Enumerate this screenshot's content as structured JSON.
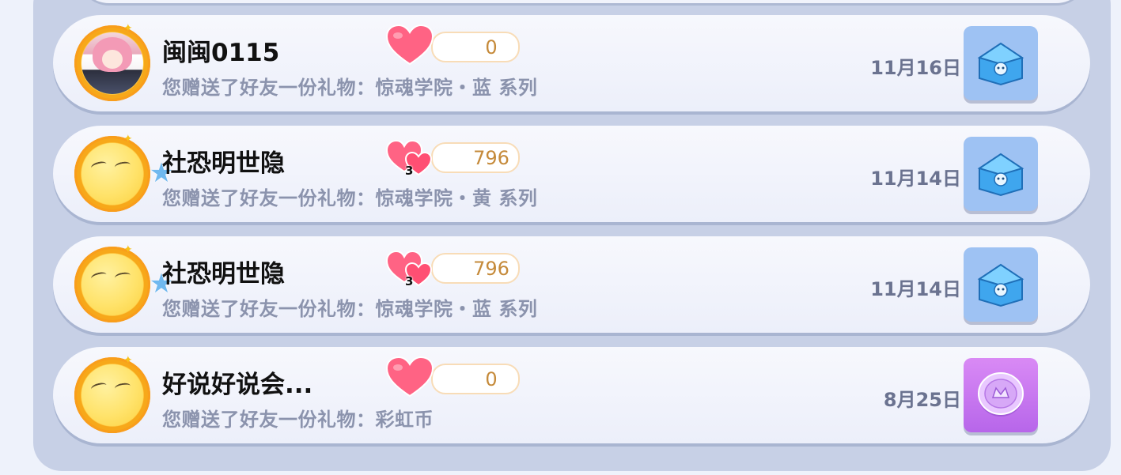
{
  "rows": [
    {
      "username": "闽闽0115",
      "subtitle": "您赠送了好友一份礼物：惊魂学院・蓝 系列",
      "like_count": "0",
      "like_badge": "",
      "date": "11月16日",
      "gift_icon": "blue-chest-icon",
      "avatar": "anime-girl-avatar"
    },
    {
      "username": "社恐明世隐",
      "subtitle": "您赠送了好友一份礼物：惊魂学院・黄 系列",
      "like_count": "796",
      "like_badge": "3",
      "date": "11月14日",
      "gift_icon": "blue-chest-icon",
      "avatar": "default-yellow-avatar"
    },
    {
      "username": "社恐明世隐",
      "subtitle": "您赠送了好友一份礼物：惊魂学院・蓝 系列",
      "like_count": "796",
      "like_badge": "3",
      "date": "11月14日",
      "gift_icon": "blue-chest-icon",
      "avatar": "default-yellow-avatar"
    },
    {
      "username": "好说好说会...",
      "subtitle": "您赠送了好友一份礼物：彩虹币",
      "like_count": "0",
      "like_badge": "",
      "date": "8月25日",
      "gift_icon": "rainbow-coin-icon",
      "avatar": "default-yellow-avatar"
    }
  ],
  "colors": {
    "panel": "#c7d0e6",
    "card": "#f1f3fb",
    "username": "#111111",
    "subtitle": "#8b93ad",
    "date": "#6b7390",
    "like_count": "#c58a3a",
    "heart": "#ff5f80",
    "gift_blue": "#9ec2f3",
    "gift_purple": "#c57cf0"
  }
}
